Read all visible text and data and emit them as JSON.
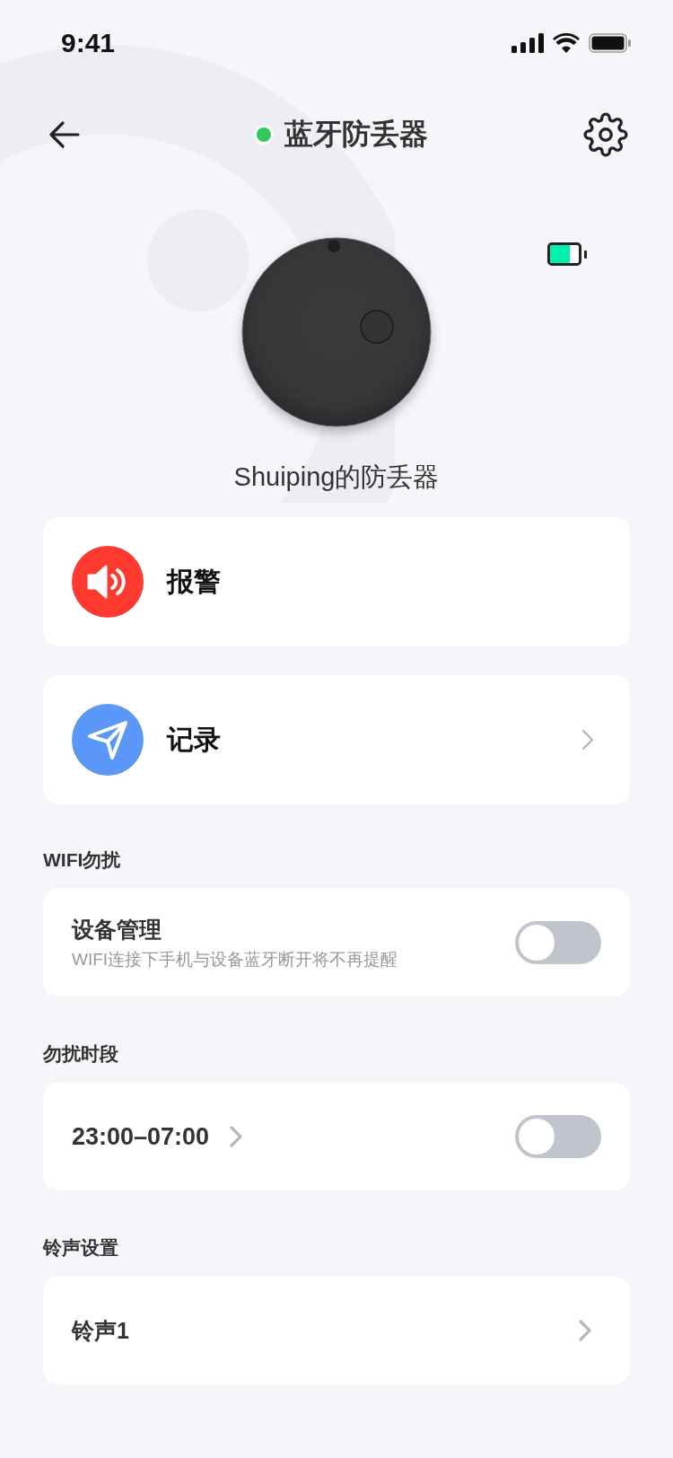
{
  "status_bar": {
    "time": "9:41"
  },
  "nav": {
    "title": "蓝牙防丢器",
    "connected": true
  },
  "device": {
    "name": "Shuiping的防丢器",
    "battery": {
      "level": 0.7
    }
  },
  "actions": [
    {
      "kind": "alarm",
      "label": "报警",
      "chevron": false
    },
    {
      "kind": "record",
      "label": "记录",
      "chevron": true
    }
  ],
  "sections": [
    {
      "title": "WIFI勿扰",
      "row": {
        "kind": "toggle",
        "label": "设备管理",
        "subtitle": "WIFI连接下手机与设备蓝牙断开将不再提醒",
        "on": false
      }
    },
    {
      "title": "勿扰时段",
      "row": {
        "kind": "time_toggle",
        "label": "23:00–07:00",
        "on": false
      }
    },
    {
      "title": "铃声设置",
      "row": {
        "kind": "link",
        "label": "铃声1"
      }
    }
  ]
}
